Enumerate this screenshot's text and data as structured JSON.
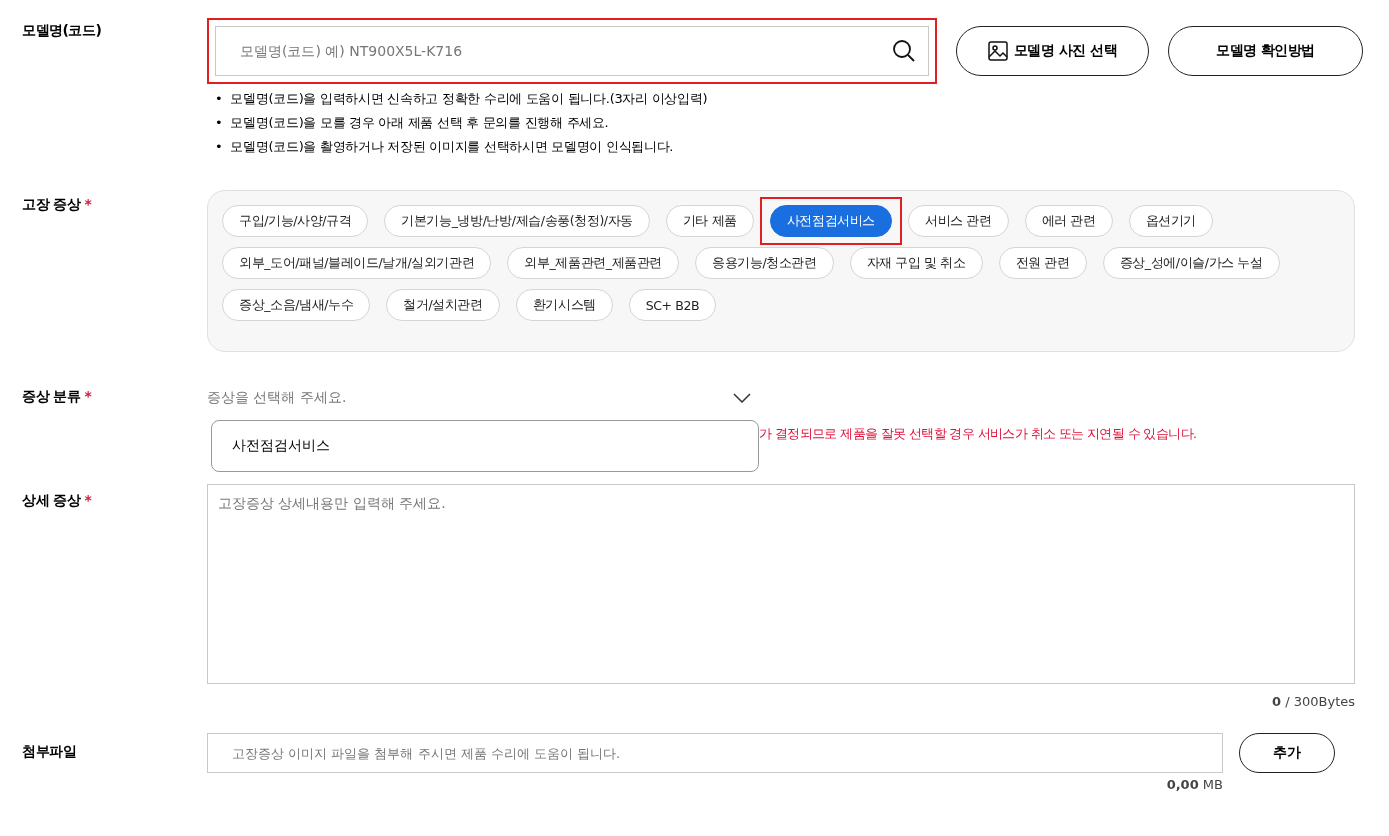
{
  "model": {
    "label": "모델명(코드)",
    "placeholder": "모델명(코드) 예) NT900X5L-K716",
    "highlighted": true,
    "buttons": [
      {
        "label": "모델명 사진 선택",
        "kind": "photo"
      },
      {
        "label": "모델명 확인방법",
        "kind": "plain"
      }
    ],
    "notes": [
      {
        "bullet": "•",
        "text": "모델명(코드)을 입력하시면 신속하고 정확한 수리에 도움이 됩니다.(3자리 이상입력)"
      },
      {
        "bullet": "•",
        "text": "모델명(코드)을 모를 경우 아래 제품 선택 후 문의를 진행해 주세요."
      },
      {
        "bullet": "•",
        "text": "모델명(코드)을 촬영하거나 저장된 이미지를 선택하시면 모델명이 인식됩니다."
      }
    ]
  },
  "symptom": {
    "label": "고장 증상",
    "required_mark": "*",
    "chips": [
      {
        "label": "구입/기능/사양/규격",
        "selected": false,
        "highlighted": false
      },
      {
        "label": "기본기능_냉방/난방/제습/송풍(청정)/자동",
        "selected": false,
        "highlighted": false
      },
      {
        "label": "기타 제품",
        "selected": false,
        "highlighted": false
      },
      {
        "label": "사전점검서비스",
        "selected": true,
        "highlighted": true
      },
      {
        "label": "서비스 관련",
        "selected": false,
        "highlighted": false
      },
      {
        "label": "에러 관련",
        "selected": false,
        "highlighted": false
      },
      {
        "label": "옵션기기",
        "selected": false,
        "highlighted": false
      },
      {
        "label": "외부_도어/패널/블레이드/날개/실외기관련",
        "selected": false,
        "highlighted": false
      },
      {
        "label": "외부_제품관련_제품관련",
        "selected": false,
        "highlighted": false
      },
      {
        "label": "응용기능/청소관련",
        "selected": false,
        "highlighted": false
      },
      {
        "label": "자재 구입 및 취소",
        "selected": false,
        "highlighted": false
      },
      {
        "label": "전원 관련",
        "selected": false,
        "highlighted": false
      },
      {
        "label": "증상_성에/이슬/가스 누설",
        "selected": false,
        "highlighted": false
      },
      {
        "label": "증상_소음/냄새/누수",
        "selected": false,
        "highlighted": false
      },
      {
        "label": "철거/설치관련",
        "selected": false,
        "highlighted": false
      },
      {
        "label": "환기시스템",
        "selected": false,
        "highlighted": false
      },
      {
        "label": "SC+ B2B",
        "selected": false,
        "highlighted": false
      }
    ]
  },
  "category": {
    "label": "증상 분류",
    "required_mark": "*",
    "placeholder": "증상을 선택해 주세요.",
    "expanded": true,
    "options": [
      "사전점검서비스"
    ],
    "warning": "가 결정되므로 제품을 잘못 선택할 경우 서비스가 취소 또는 지연될 수 있습니다."
  },
  "detail": {
    "label": "상세 증상",
    "required_mark": "*",
    "placeholder": "고장증상 상세내용만 입력해 주세요.",
    "counter": "**0** / 300Bytes"
  },
  "attachment": {
    "label": "첨부파일",
    "placeholder": "고장증상 이미지 파일을 첨부해 주시면 제품 수리에 도움이 됩니다.",
    "button": "추가",
    "size": "**0,00** MB"
  }
}
